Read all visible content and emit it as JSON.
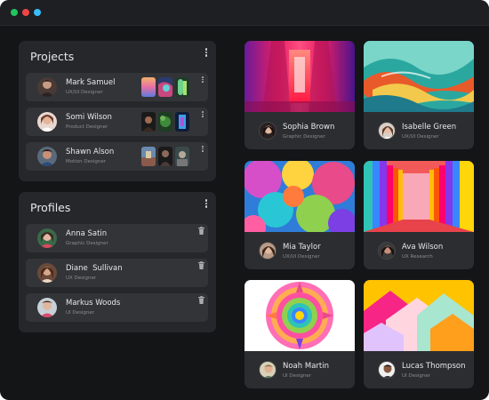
{
  "window": {
    "traffic_lights": [
      "green",
      "red",
      "blue"
    ]
  },
  "projects": {
    "title": "Projects",
    "items": [
      {
        "name": "Mark Samuel",
        "role": "UX/UI Designer"
      },
      {
        "name": "Somi Wilson",
        "role": "Product Designer"
      },
      {
        "name": "Shawn Alson",
        "role": "Motion Designer"
      }
    ]
  },
  "profiles": {
    "title": "Profiles",
    "items": [
      {
        "name": "Anna Satin",
        "role": "Graphic Designer"
      },
      {
        "name": "Diane  Sullivan",
        "role": "UX Designer"
      },
      {
        "name": "Markus Woods",
        "role": "UI Designer"
      }
    ]
  },
  "gallery": [
    {
      "name": "Sophia Brown",
      "role": "Graphic Designer"
    },
    {
      "name": "Isabelle Green",
      "role": "UX/UI Designer"
    },
    {
      "name": "Mia Taylor",
      "role": "UX/UI Designer"
    },
    {
      "name": "Ava Wilson",
      "role": "UX Research"
    },
    {
      "name": "Noah Martin",
      "role": "UI Designer"
    },
    {
      "name": "Lucas Thompson",
      "role": "UI Designer"
    }
  ],
  "colors": {
    "background": "#141517",
    "panel": "#26272b",
    "row": "#333438",
    "card": "#2c2d31"
  }
}
